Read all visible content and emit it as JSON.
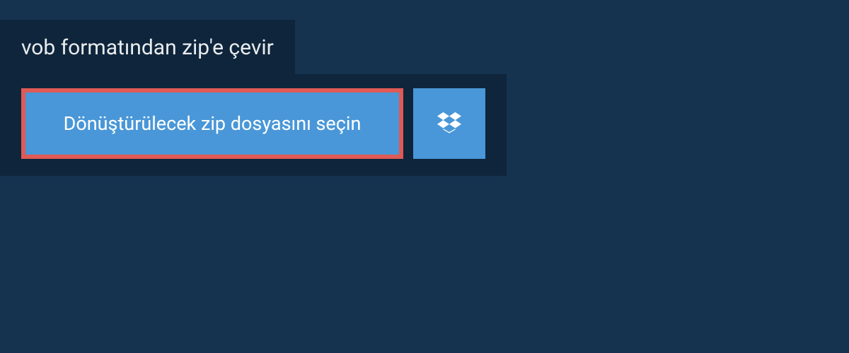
{
  "header": {
    "title": "vob formatından zip'e çevir"
  },
  "actions": {
    "choose_file_label": "Dönüştürülecek zip dosyasını seçin",
    "dropbox_icon": "dropbox-icon"
  },
  "colors": {
    "page_bg": "#15334f",
    "panel_bg": "#0f253b",
    "button_bg": "#4997d8",
    "highlight_border": "#e05a55",
    "text_light": "#ffffff"
  }
}
